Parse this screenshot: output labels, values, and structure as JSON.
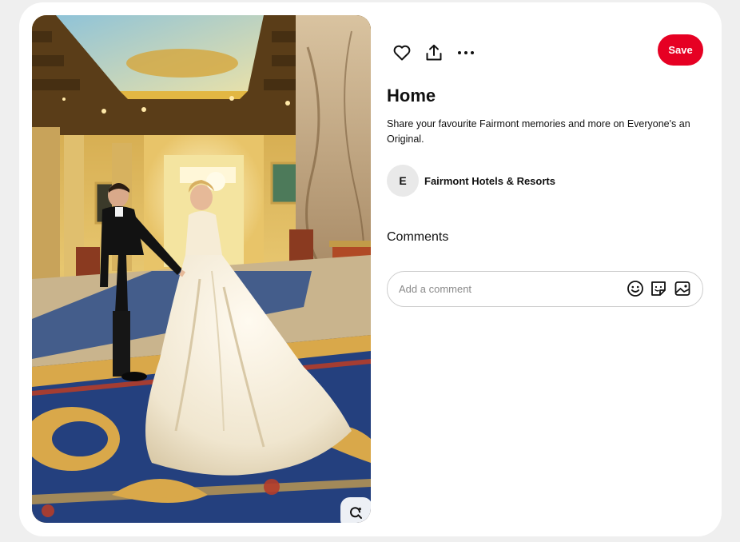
{
  "pin": {
    "image_alt": "Bride and groom in ornate hotel lobby",
    "visual_search_icon": "visual-search-icon"
  },
  "toolbar": {
    "like_icon": "heart-icon",
    "share_icon": "share-icon",
    "more_icon": "more-dots-icon",
    "save_label": "Save"
  },
  "board": {
    "title": "Home",
    "description": "Share your favourite Fairmont memories and more on Everyone's an Original."
  },
  "creator": {
    "avatar_initial": "E",
    "name": "Fairmont Hotels & Resorts"
  },
  "comments": {
    "heading": "Comments",
    "placeholder": "Add a comment",
    "emoji_icon": "emoji-icon",
    "sticker_icon": "sticker-icon",
    "image_icon": "image-icon"
  },
  "colors": {
    "save_bg": "#e60023",
    "card_bg": "#ffffff",
    "page_bg": "#efefef"
  }
}
